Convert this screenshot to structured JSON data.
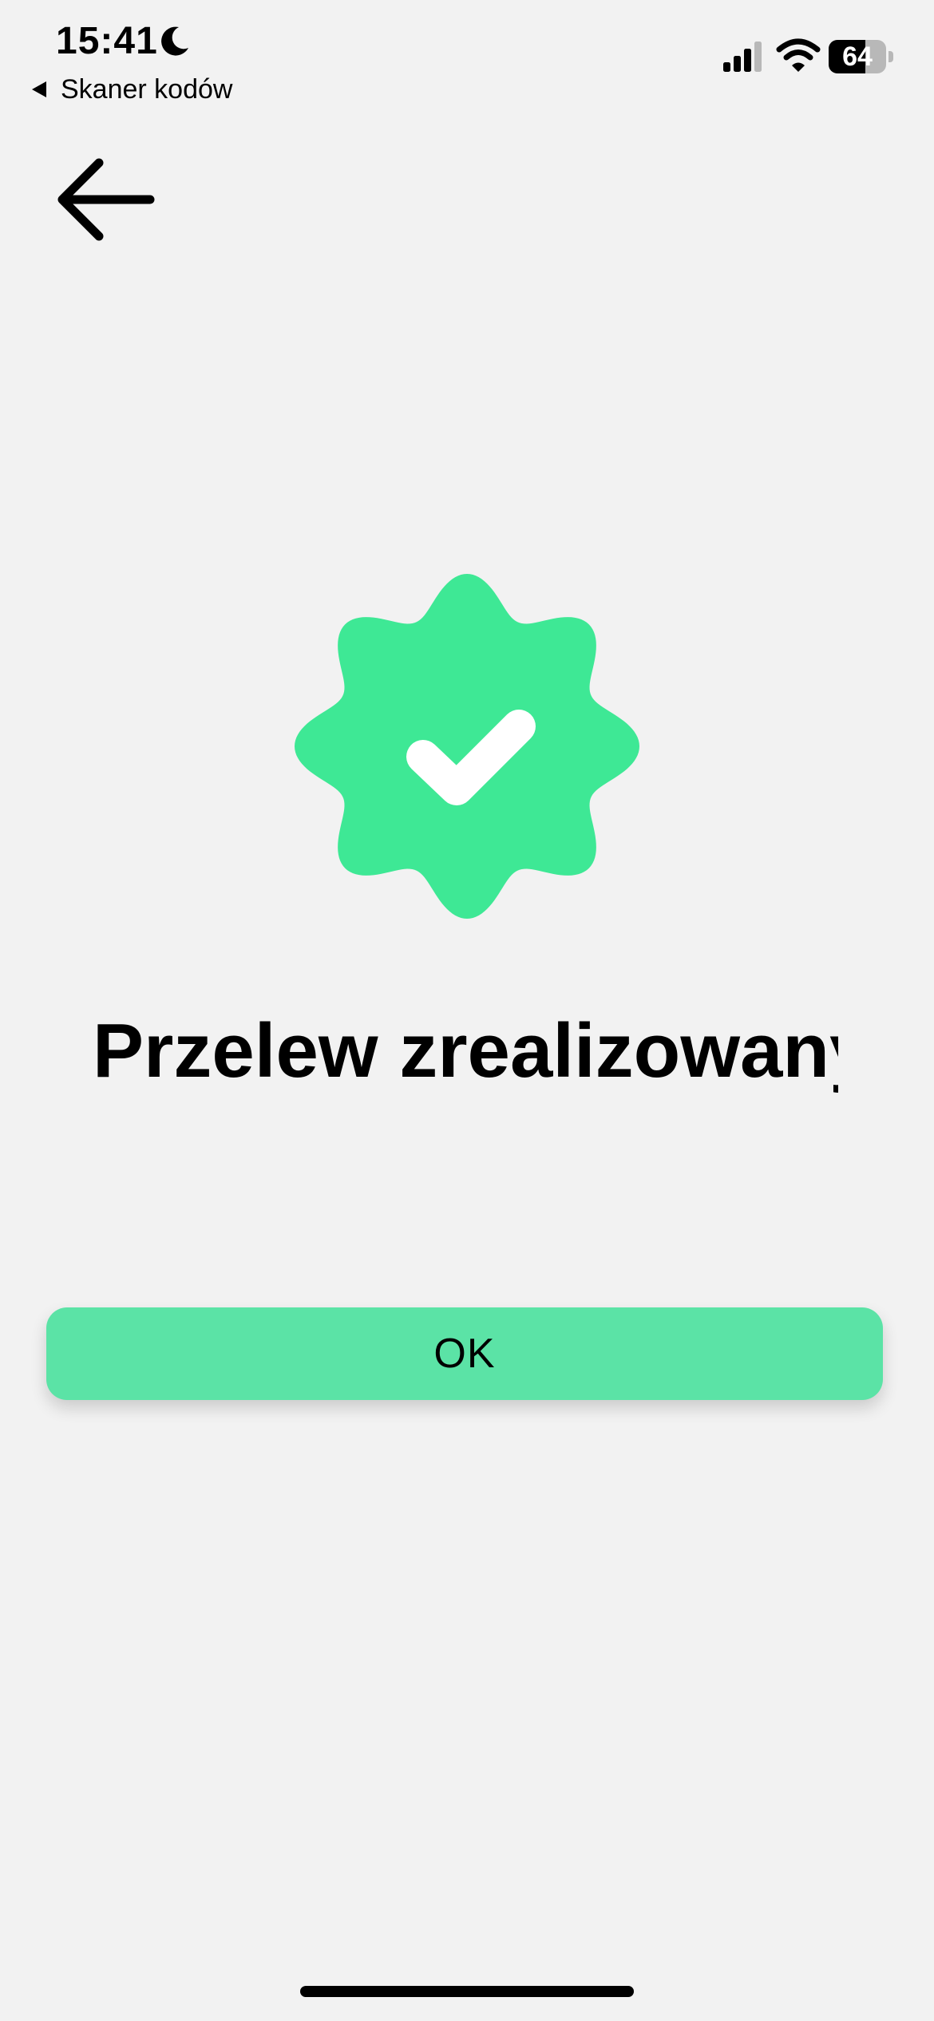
{
  "status_bar": {
    "time": "15:41",
    "back_app_label": "Skaner kodów",
    "battery_level": "64",
    "battery_fraction": 0.64,
    "icons": [
      "moon-icon",
      "signal-icon",
      "wifi-icon",
      "battery-icon"
    ]
  },
  "nav": {
    "back_icon": "arrow-left-icon"
  },
  "result": {
    "icon": "verified-badge-check-icon",
    "title": "Przelew zrealizowany"
  },
  "actions": {
    "ok_label": "OK"
  },
  "colors": {
    "background": "#f2f2f2",
    "badge": "#3ee895",
    "button": "#5be3a6",
    "text": "#000000"
  }
}
